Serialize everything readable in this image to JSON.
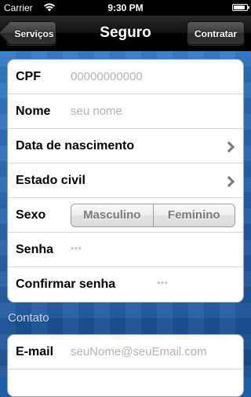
{
  "status_bar": {
    "carrier": "Carrier",
    "time": "9:30 PM",
    "battery_level": 0.9
  },
  "nav": {
    "back_label": "Serviços",
    "title": "Seguro",
    "action_label": "Contratar"
  },
  "form": {
    "cpf": {
      "label": "CPF",
      "placeholder": "00000000000"
    },
    "nome": {
      "label": "Nome",
      "placeholder": "seu nome"
    },
    "data_nascimento": {
      "label": "Data de nascimento"
    },
    "estado_civil": {
      "label": "Estado civil"
    },
    "sexo": {
      "label": "Sexo",
      "options": [
        "Masculino",
        "Feminino"
      ]
    },
    "senha": {
      "label": "Senha",
      "placeholder": "***"
    },
    "confirmar_senha": {
      "label": "Confirmar senha",
      "placeholder": "***"
    }
  },
  "contato": {
    "header": "Contato",
    "email": {
      "label": "E-mail",
      "placeholder": "seuNome@seuEmail.com"
    }
  }
}
